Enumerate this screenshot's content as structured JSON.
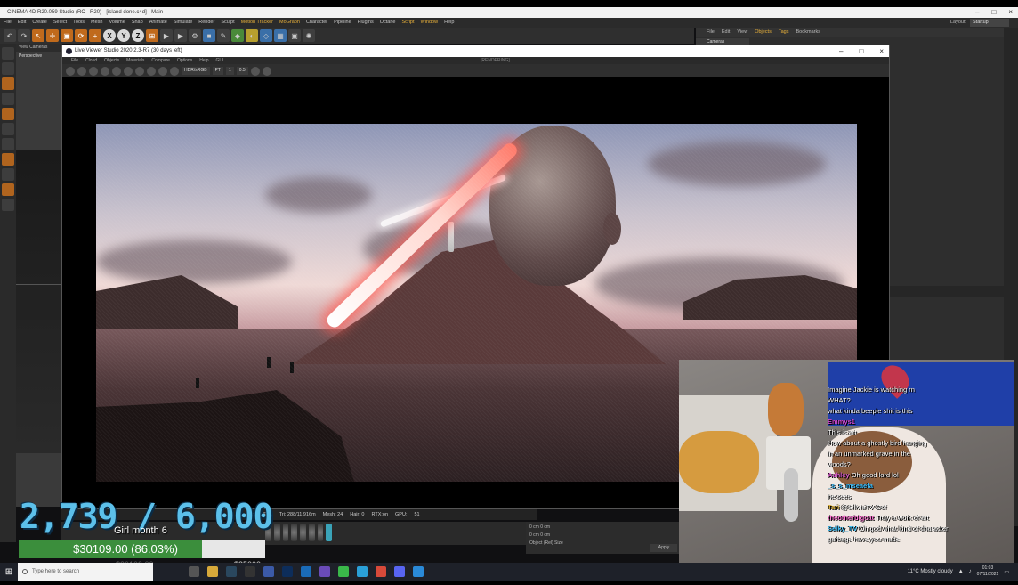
{
  "c4d": {
    "title": "CINEMA 4D R20.059 Studio (RC - R20) - [island done.c4d] - Main",
    "menu": [
      "File",
      "Edit",
      "Create",
      "Select",
      "Tools",
      "Mesh",
      "Volume",
      "Snap",
      "Animate",
      "Simulate",
      "Render",
      "Sculpt",
      "Motion Tracker",
      "MoGraph",
      "Character",
      "Pipeline",
      "Plugins",
      "Octane",
      "Script",
      "Window",
      "Help"
    ],
    "layout_label": "Layout:",
    "layout_value": "Startup",
    "viewport_menu": "View  Cameras",
    "viewport_label": "Perspective",
    "object_tabs": [
      "File",
      "Edit",
      "View",
      "Objects",
      "Tags",
      "Bookmarks"
    ],
    "object_item": "Cameras"
  },
  "live_viewer": {
    "title": "Live Viewer Studio 2020.2.3-R7 (30 days left)",
    "menu": [
      "File",
      "Cloud",
      "Objects",
      "Materials",
      "Compare",
      "Options",
      "Help",
      "GUI"
    ],
    "center_label": "[RENDERING]",
    "mode_select": "HDR/sRGB",
    "pass_select": "PT",
    "zoom_a": "1",
    "zoom_b": "0.5",
    "status": [
      "spp: 2/900",
      "Tri: 288/11.916m",
      "Mesh: 24",
      "Hair: 0",
      "RTX:on",
      "GPU:",
      "51"
    ]
  },
  "attributes": {
    "row1": "0 cm        0 cm",
    "row2": "0 cm        0 cm",
    "row3": "Object (Rel)      Size",
    "apply": "Apply"
  },
  "overlay": {
    "counter": "2,739 / 6,000",
    "goal_title": "Girl month 6",
    "goal_text": "$30109.00 (86.03%)",
    "goal_progress": 0.8603,
    "goal_max": "$35000",
    "goal_prev": "$30109.00"
  },
  "chat": [
    {
      "user": "",
      "text": "Imagine Jackie is watching rn",
      "color": "#ffffff"
    },
    {
      "user": "",
      "text": "WHAT?",
      "color": "#ffffff"
    },
    {
      "user": "",
      "text": "what kinda beeple shit is this",
      "color": "#ffffff"
    },
    {
      "user": "Emmys1",
      "text": "",
      "color": "#d44ad4"
    },
    {
      "user": "",
      "text": "This is art",
      "color": "#ffffff"
    },
    {
      "user": "",
      "text": "How about a ghostly bird hanging",
      "color": "#ffffff"
    },
    {
      "user": "",
      "text": "in an unmarked grave in the",
      "color": "#ffffff"
    },
    {
      "user": "",
      "text": "woods?",
      "color": "#ffffff"
    },
    {
      "user": "Ashley",
      "text": "Oh good lord lol",
      "color": "#e05fd4"
    },
    {
      "user": "_s_s_mseaeta",
      "text": "",
      "color": "#41c2ff"
    },
    {
      "user": "",
      "text": "he sees",
      "color": "#ffffff"
    },
    {
      "user": "Tari",
      "text": "@SillviaTV Oof",
      "color": "#e3b73c"
    },
    {
      "user": "theotherbigcat",
      "text": "Truly a work of art",
      "color": "#ff7ad6"
    },
    {
      "user": "Selky_TV",
      "text": "Oh god what kind of character",
      "color": "#46c8ff"
    },
    {
      "user": "",
      "text": "garbage have you made",
      "color": "#ffffff"
    }
  ],
  "taskbar": {
    "search_placeholder": "Type here to search",
    "weather": "11°C  Mostly cloudy",
    "time": "01:03",
    "date": "07/11/2021"
  }
}
